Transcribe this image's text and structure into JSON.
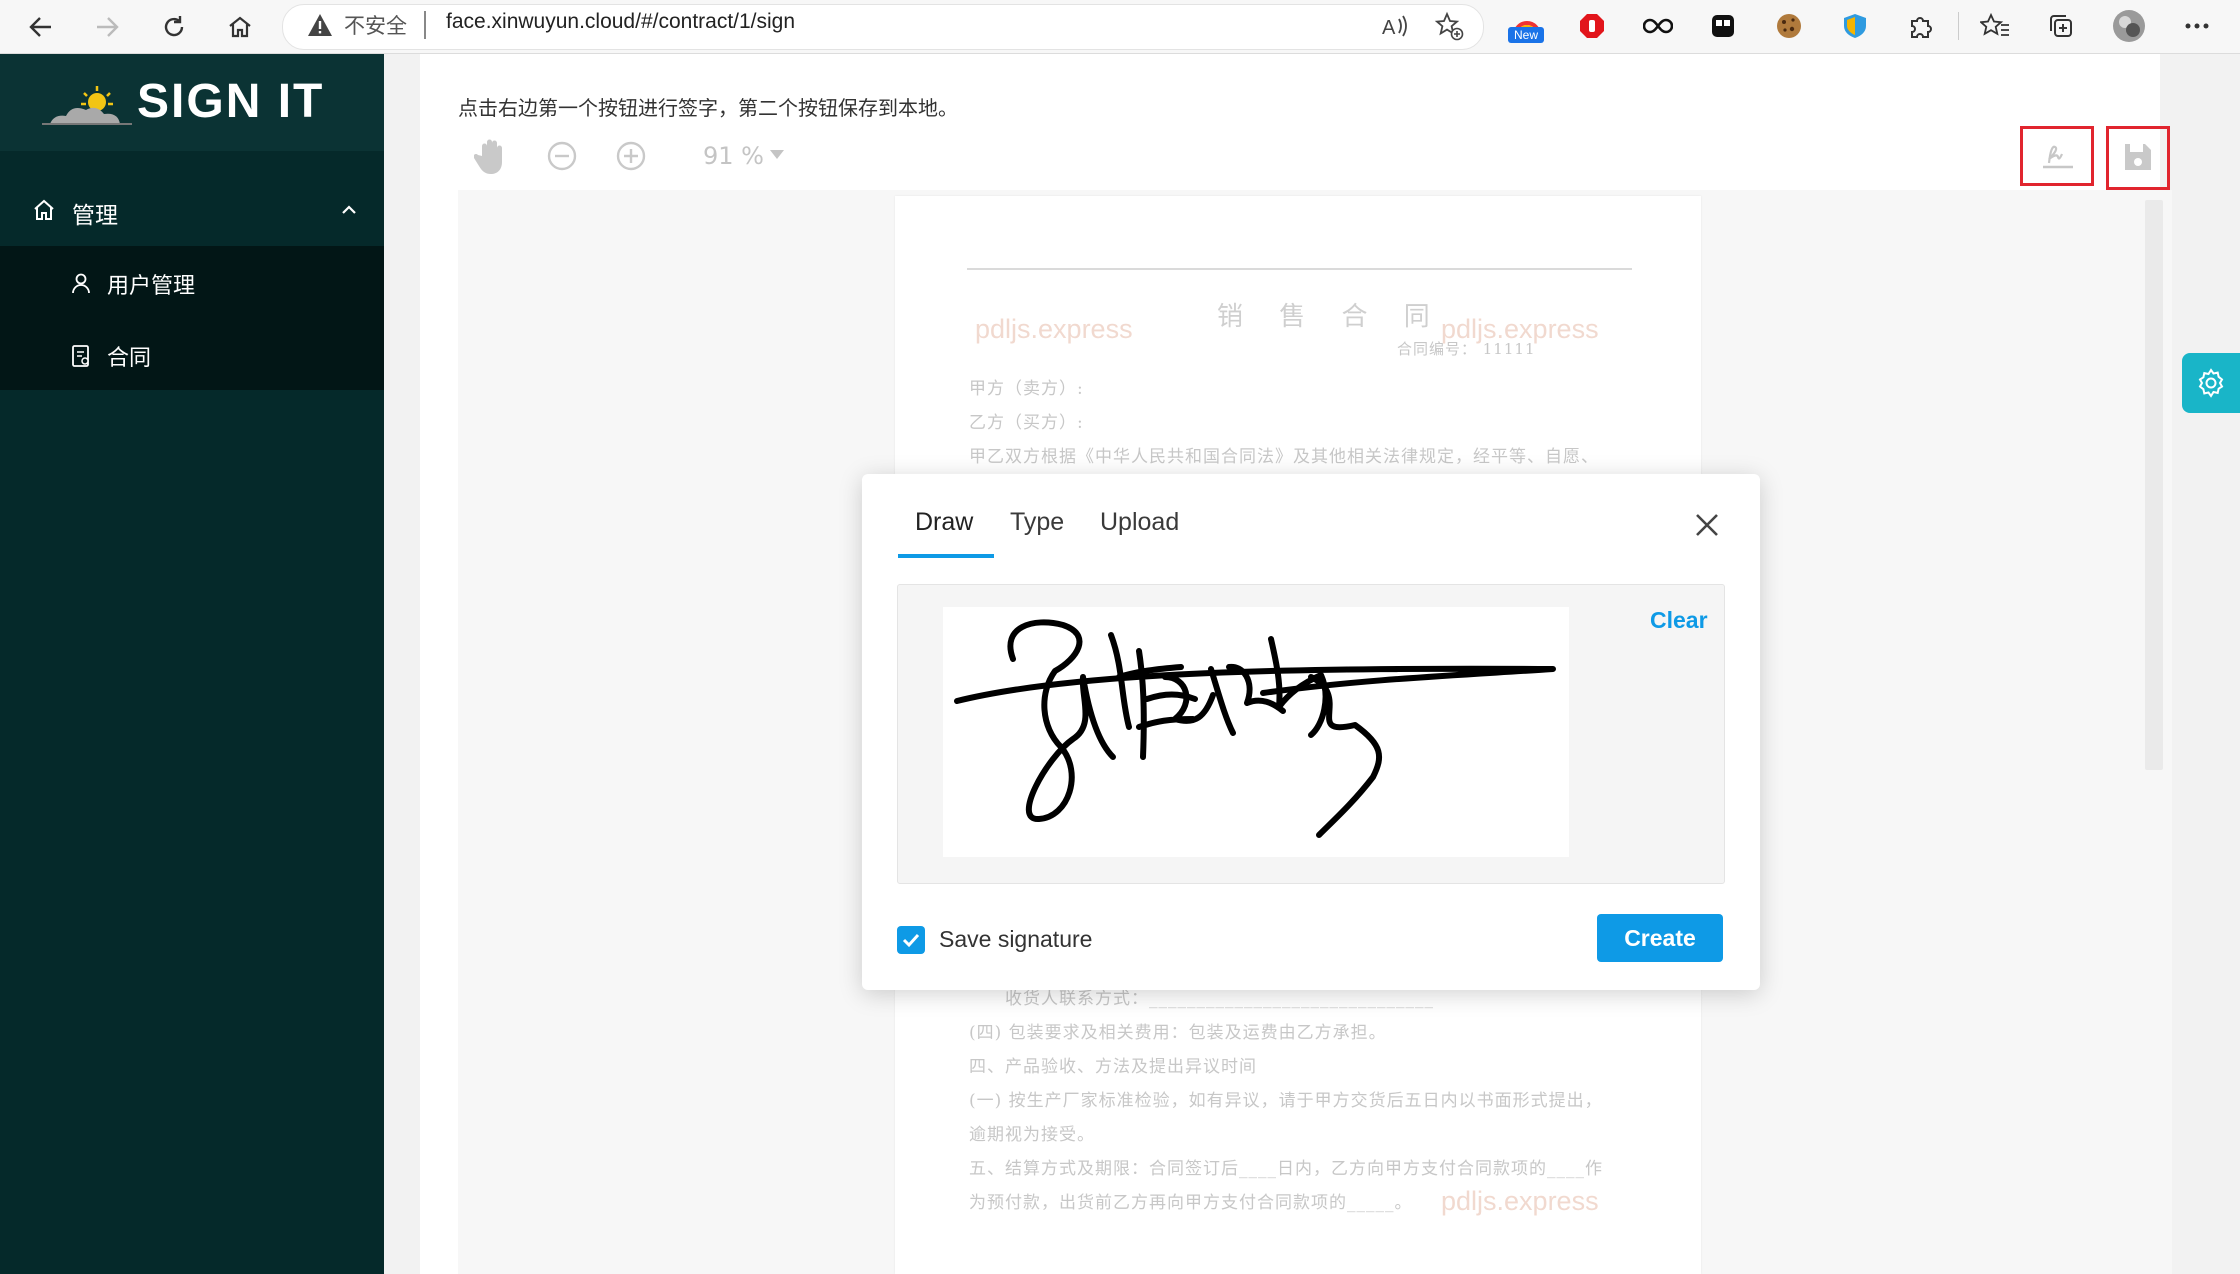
{
  "browser": {
    "security_label": "不安全",
    "url": "face.xinwuyun.cloud/#/contract/1/sign",
    "new_badge": "New"
  },
  "sidebar": {
    "logo_text": "SIGN IT",
    "menu_title": "管理",
    "items": [
      {
        "label": "用户管理"
      },
      {
        "label": "合同"
      }
    ]
  },
  "main": {
    "instruction": "点击右边第一个按钮进行签字，第二个按钮保存到本地。",
    "zoom": "91 %"
  },
  "document": {
    "title": "销 售 合 同",
    "contract_no": "合同编号： 11111",
    "watermark": "pdljs.express",
    "lines_top": [
      "甲方（卖方）:",
      "乙方（买方）:",
      "甲乙双方根据《中华人民共和国合同法》及其他相关法律规定，经平等、自愿、"
    ],
    "lines_bottom": [
      "收货人联系方式：______________________________",
      "(四)  包装要求及相关费用：包装及运费由乙方承担。",
      "四、产品验收、方法及提出异议时间",
      "(一)  按生产厂家标准检验，如有异议，请于甲方交货后五日内以书面形式提出，",
      "逾期视为接受。",
      "五、结算方式及期限：合同签订后____日内，乙方向甲方支付合同款项的____作",
      "为预付款，出货前乙方再向甲方支付合同款项的_____。"
    ]
  },
  "modal": {
    "tabs": [
      "Draw",
      "Type",
      "Upload"
    ],
    "clear_label": "Clear",
    "save_signature_label": "Save signature",
    "save_signature_checked": true,
    "create_label": "Create"
  },
  "colors": {
    "sidebar_bg": "#05292a",
    "accent": "#0e9ae6",
    "highlight_box": "#e1252e",
    "settings_tab": "#19b5c8"
  }
}
